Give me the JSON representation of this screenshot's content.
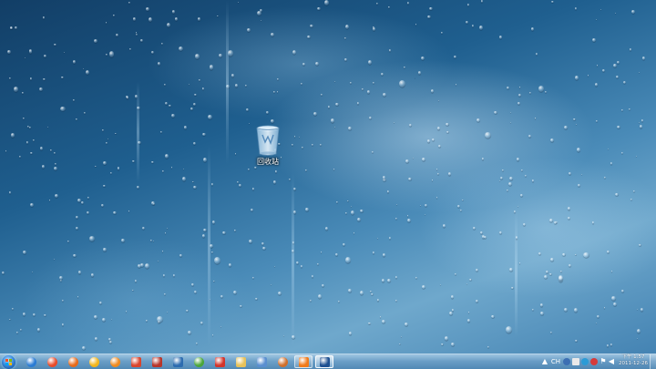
{
  "desktop": {
    "icons": [
      {
        "label": "回收站",
        "icon": "recycle-bin-icon"
      }
    ]
  },
  "taskbar": {
    "start": {
      "icon": "windows-start-orb-icon"
    },
    "items": [
      {
        "icon": "internet-explorer-icon",
        "state": "pinned",
        "color": "#2a7bd4"
      },
      {
        "icon": "chrome-icon",
        "state": "pinned",
        "color": "#e84b2a"
      },
      {
        "icon": "firefox-icon",
        "state": "pinned",
        "color": "#e66a1a"
      },
      {
        "icon": "sun-app-icon",
        "state": "pinned",
        "color": "#f2b51b"
      },
      {
        "icon": "orange-circle-app-icon",
        "state": "pinned",
        "color": "#f08a1e"
      },
      {
        "icon": "checkmark-tool-icon",
        "state": "pinned",
        "color": "#d9442c"
      },
      {
        "icon": "red-square-app-icon",
        "state": "pinned",
        "color": "#b8352a"
      },
      {
        "icon": "monitor-app-icon",
        "state": "pinned",
        "color": "#2d6cb0"
      },
      {
        "icon": "utorrent-icon",
        "state": "pinned",
        "color": "#4aa63a"
      },
      {
        "icon": "red-swoosh-app-icon",
        "state": "pinned",
        "color": "#d3342b"
      },
      {
        "icon": "folder-icon",
        "state": "pinned",
        "color": "#e7c25a"
      },
      {
        "icon": "wand-tool-icon",
        "state": "pinned",
        "color": "#5a8fd0"
      },
      {
        "icon": "globe-app-icon",
        "state": "pinned",
        "color": "#cf6f2c"
      },
      {
        "icon": "orange-k-app-icon",
        "state": "running",
        "color": "#f07a1a"
      },
      {
        "icon": "photoshop-icon",
        "state": "active",
        "color": "#1d4f91"
      }
    ]
  },
  "tray": {
    "input_method_text": "CH",
    "clock": {
      "time": "下午 1:57",
      "date": "2011-12-26"
    }
  }
}
